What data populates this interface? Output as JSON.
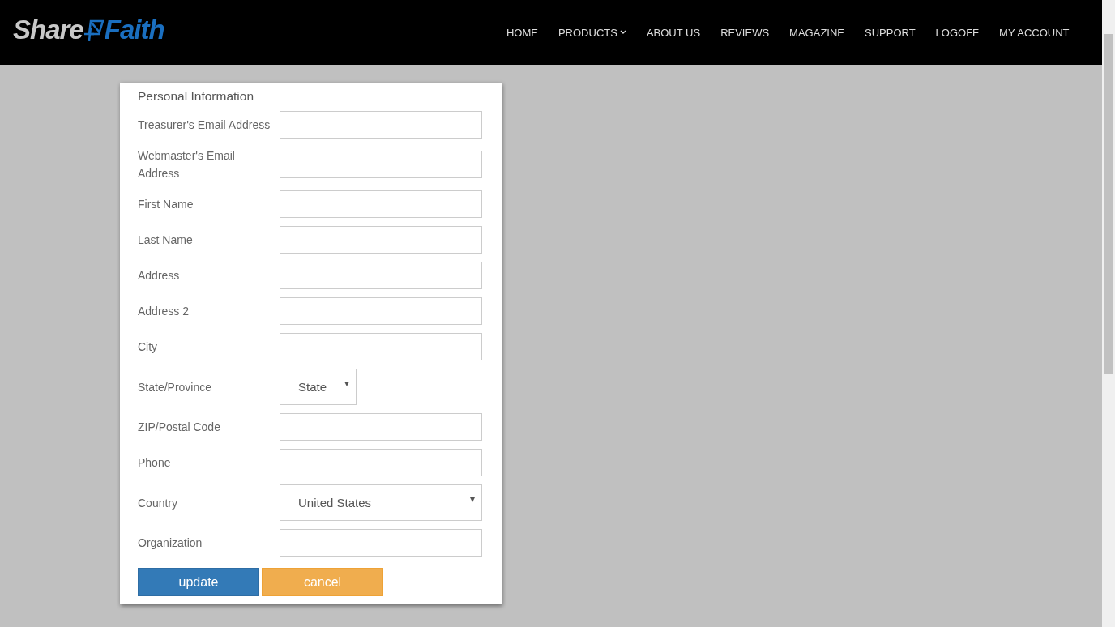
{
  "header": {
    "logo": {
      "first": "Share",
      "second": "Faith"
    },
    "nav": [
      {
        "label": "HOME",
        "has_menu": false
      },
      {
        "label": "PRODUCTS",
        "has_menu": true
      },
      {
        "label": "ABOUT US",
        "has_menu": false
      },
      {
        "label": "REVIEWS",
        "has_menu": false
      },
      {
        "label": "MAGAZINE",
        "has_menu": false
      },
      {
        "label": "SUPPORT",
        "has_menu": false
      },
      {
        "label": "LOGOFF",
        "has_menu": false
      },
      {
        "label": "MY ACCOUNT",
        "has_menu": false
      }
    ]
  },
  "form": {
    "title": "Personal Information",
    "fields": [
      {
        "label": "Treasurer's Email Address",
        "kind": "text"
      },
      {
        "label": "Webmaster's Email Address",
        "kind": "text"
      },
      {
        "label": "First Name",
        "kind": "text"
      },
      {
        "label": "Last Name",
        "kind": "text"
      },
      {
        "label": "Address",
        "kind": "text"
      },
      {
        "label": "Address 2",
        "kind": "text"
      },
      {
        "label": "City",
        "kind": "text"
      },
      {
        "label": "State/Province",
        "kind": "select-short",
        "value": "State"
      },
      {
        "label": "ZIP/Postal Code",
        "kind": "text"
      },
      {
        "label": "Phone",
        "kind": "text"
      },
      {
        "label": "Country",
        "kind": "select",
        "value": "United States"
      },
      {
        "label": "Organization",
        "kind": "text"
      }
    ],
    "buttons": [
      {
        "label": "update",
        "kind": "primary"
      },
      {
        "label": "cancel",
        "kind": "secondary"
      }
    ]
  }
}
